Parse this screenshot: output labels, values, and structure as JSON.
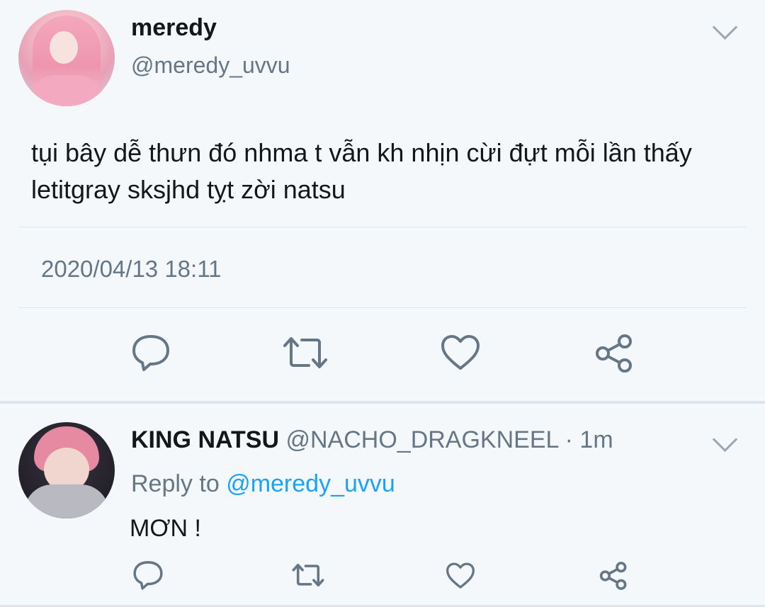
{
  "main_tweet": {
    "display_name": "meredy",
    "handle": "@meredy_uvvu",
    "text": "tụi bây dễ thưn đó nhma t vẫn kh nhịn cừi đựt mỗi lần thấy letitgray sksjhd tỵt zời natsu",
    "timestamp": "2020/04/13 18:11",
    "icons": {
      "reply": "reply-bubble-icon",
      "retweet": "retweet-icon",
      "like": "heart-icon",
      "share": "share-icon",
      "menu": "chevron-down-icon"
    }
  },
  "reply_tweet": {
    "display_name": "KING NATSU",
    "handle": "@NACHO_DRAGKNEEL",
    "separator": "·",
    "time_ago": "1m",
    "reply_to_label": "Reply to",
    "reply_to_handle": "@meredy_uvvu",
    "text": "MƠN !"
  },
  "colors": {
    "background": "#f5f8fa",
    "primary_text": "#14171a",
    "secondary_text": "#657786",
    "link": "#1da1f2",
    "icon": "#657786",
    "divider": "#e1e8ed"
  }
}
